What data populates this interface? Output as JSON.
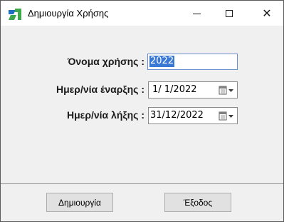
{
  "window": {
    "title": "Δημιουργία Χρήσης",
    "icon": "app-logo-icon",
    "controls": {
      "minimize": "minimize-icon",
      "maximize": "maximize-icon",
      "close_glyph": "✕"
    }
  },
  "form": {
    "usage_name": {
      "label": "Όνομα χρήσης :",
      "value": "2022"
    },
    "start_date": {
      "label": "Ημερ/νία έναρξης :",
      "value": "1/ 1/2022"
    },
    "end_date": {
      "label": "Ημερ/νία λήξης :",
      "value": "31/12/2022"
    }
  },
  "buttons": {
    "create": "Δημιουργία",
    "exit": "Έξοδος"
  },
  "colors": {
    "accent_selection": "#3a78d6",
    "icon_blue": "#1f6fc2",
    "icon_green": "#3da94a"
  }
}
